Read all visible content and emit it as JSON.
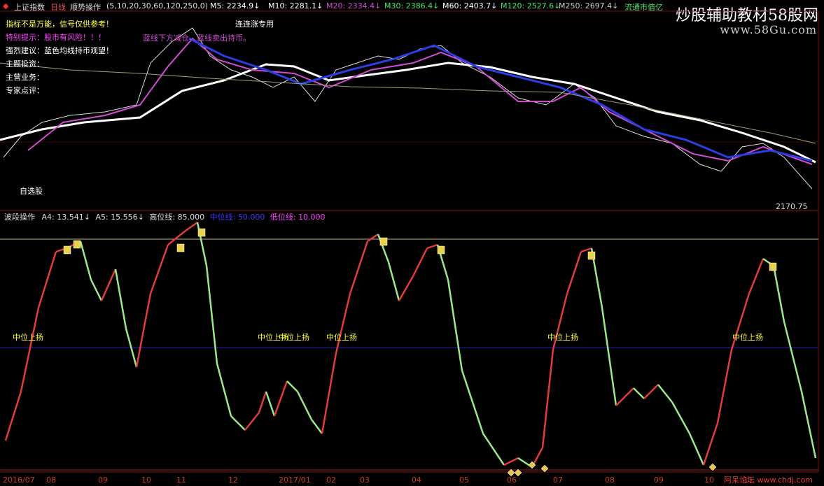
{
  "header": {
    "logo_icon": "red-diamond",
    "index_name": "上证指数",
    "period": "日线",
    "formula": "顺势操作",
    "params": "(5,10,20,30,60,120,250,0)",
    "ma": [
      {
        "label": "M5:",
        "value": "2234.9",
        "arrow": "↓",
        "color": "#ffffff"
      },
      {
        "label": "M10:",
        "value": "2281.1",
        "arrow": "↓",
        "color": "#ffffff"
      },
      {
        "label": "M20:",
        "value": "2334.4",
        "arrow": "↓",
        "color": "#d24bd2"
      },
      {
        "label": "M30:",
        "value": "2386.4",
        "arrow": "↓",
        "color": "#4be36f"
      },
      {
        "label": "M60:",
        "value": "2403.7",
        "arrow": "↓",
        "color": "#ffffff"
      },
      {
        "label": "M120:",
        "value": "2527.6",
        "arrow": "↓",
        "color": "#4be36f"
      },
      {
        "label": "M250:",
        "value": "2697.4",
        "arrow": "↓",
        "color": "#cfcfcf"
      }
    ],
    "extra": "流通市值亿"
  },
  "watermark": {
    "text": "炒股辅助教材58股网",
    "url": "www.58Gu.com"
  },
  "upper_notes": [
    {
      "text": "指标不是万能，信号仅供参考！",
      "color": "#ffff40"
    },
    {
      "text": "特别提示：股市有风险！！！",
      "color": "#ff40ff"
    },
    {
      "text": "强烈建议：蓝色均线持币观望！",
      "color": "#ffffff"
    },
    {
      "text": "主题投资：",
      "color": "#ffffff"
    },
    {
      "text": "主营业务：",
      "color": "#ffffff"
    },
    {
      "text": "专家点评：",
      "color": "#ffffff"
    }
  ],
  "upper_labels": {
    "tag_up": "连连涨专用",
    "tag_warn": "蓝线下方减仓，蓝线卖出持币。",
    "watchlist": "自选股",
    "price_low": "2170.75"
  },
  "lower_header": {
    "name": "波段操作",
    "a4_label": "A4:",
    "a4_value": "13.541",
    "a4_arrow": "↓",
    "a5_label": "A5:",
    "a5_value": "15.556",
    "a5_arrow": "↓",
    "high_label": "高位线:",
    "high_value": "85.000",
    "mid_label": "中位线:",
    "mid_value": "50.000",
    "low_label": "低位线:",
    "low_value": "10.000"
  },
  "signals": {
    "mid_up": "中位上扬"
  },
  "x_axis": [
    "2016/07",
    "08",
    "09",
    "10",
    "11",
    "12",
    "2017/01",
    "02",
    "03",
    "04",
    "05",
    "06",
    "07",
    "08",
    "09",
    "10",
    "11"
  ],
  "footer_brand": "阿呆论坛 www.chdj.com",
  "colors": {
    "rise": "#e23b3b",
    "fall": "#9be88a",
    "ma_white": "#ffffff",
    "ma_purple": "#d24bd2",
    "ma_blue": "#2c3ee0",
    "ma_green": "#4bb84b",
    "grid_red": "#7a1010",
    "mid_line": "#2222aa",
    "high_line": "#c8b37a"
  }
}
